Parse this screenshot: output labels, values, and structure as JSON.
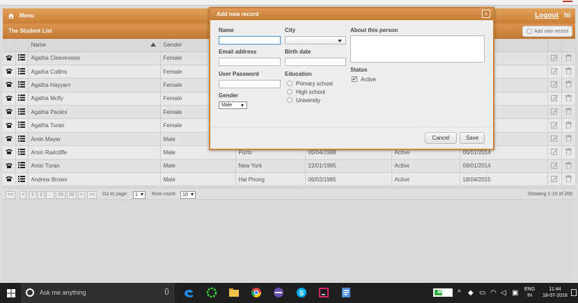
{
  "menubar": {
    "menu_label": "Menu",
    "logout_label": "Logout",
    "hi_label": "hi"
  },
  "list": {
    "title": "The Student List",
    "add_button_label": "Add new record",
    "columns": [
      "Name",
      "Gender"
    ],
    "rows": [
      {
        "name": "Agatha Cleeveoooo",
        "gender": "Female",
        "city": "",
        "birth": "",
        "status": "",
        "date": ""
      },
      {
        "name": "Agatha Collins",
        "gender": "Female",
        "city": "",
        "birth": "",
        "status": "",
        "date": ""
      },
      {
        "name": "Agatha Hayyam",
        "gender": "Female",
        "city": "",
        "birth": "",
        "status": "",
        "date": ""
      },
      {
        "name": "Agatha Mcfly",
        "gender": "Female",
        "city": "",
        "birth": "",
        "status": "",
        "date": ""
      },
      {
        "name": "Agatha Paolini",
        "gender": "Female",
        "city": "",
        "birth": "",
        "status": "",
        "date": ""
      },
      {
        "name": "Agatha Turan",
        "gender": "Female",
        "city": "",
        "birth": "",
        "status": "",
        "date": ""
      },
      {
        "name": "Amin Mayer",
        "gender": "Male",
        "city": "",
        "birth": "",
        "status": "",
        "date": ""
      },
      {
        "name": "Amin Radcliffe",
        "gender": "Male",
        "city": "Porto",
        "birth": "05/04/1998",
        "status": "Active",
        "date": "05/01/2014"
      },
      {
        "name": "Amin Turan",
        "gender": "Male",
        "city": "New York",
        "birth": "22/01/1995",
        "status": "Active",
        "date": "09/01/2014"
      },
      {
        "name": "Andrew Brown",
        "gender": "Male",
        "city": "Hai Phong",
        "birth": "06/02/1985",
        "status": "Active",
        "date": "18/04/2015"
      }
    ]
  },
  "pager": {
    "first": "<<",
    "prev": "<",
    "p1": "1",
    "p2": "2",
    "ellipsis": "...",
    "p19": "19",
    "p20": "20",
    "next": ">",
    "last": ">>",
    "goto_label": "Go to page:",
    "goto_value": "1",
    "rowcount_label": "Row count:",
    "rowcount_value": "10",
    "showing": "Showing 1-10 of 200"
  },
  "dialog": {
    "title": "Add new record",
    "close": "×",
    "name_label": "Name",
    "city_label": "City",
    "about_label": "About this person",
    "email_label": "Email address",
    "birth_label": "Birth date",
    "password_label": "User Password",
    "education_label": "Education",
    "education_options": [
      "Primary school",
      "High school",
      "University"
    ],
    "gender_label": "Gender",
    "gender_value": "Male",
    "status_label": "Status",
    "status_option": "Active",
    "status_checked_mark": "✔",
    "cancel_label": "Cancel",
    "save_label": "Save"
  },
  "taskbar": {
    "search_placeholder": "Ask me anything",
    "battery_percent": "46%",
    "battery_level": 0.46,
    "lang_line1": "ENG",
    "lang_line2": "IN",
    "time": "11:44",
    "date": "18-07-2016"
  }
}
